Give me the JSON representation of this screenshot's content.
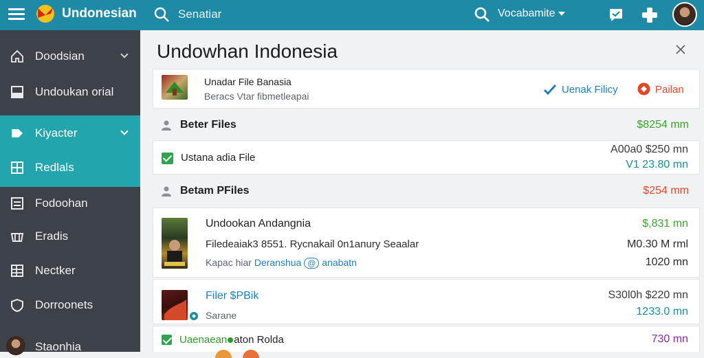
{
  "topbar": {
    "app_name": "Undonesian",
    "search_placeholder": "Senatiar",
    "dropdown_label": "Vocabamite",
    "icons": [
      "menu-icon",
      "logo-icon",
      "search-icon",
      "chat-icon",
      "gamepad-icon"
    ]
  },
  "sidebar": {
    "items": [
      {
        "label": "Doodsian",
        "icon": "home-icon",
        "chevron": true
      },
      {
        "label": "Undoukan orial",
        "icon": "square-icon",
        "chevron": false
      },
      {
        "label": "Kiyacter",
        "icon": "tag-icon",
        "chevron": true
      },
      {
        "label": "Redlals",
        "icon": "grid-icon",
        "chevron": false
      },
      {
        "label": "Fodoohan",
        "icon": "list-icon",
        "chevron": false
      },
      {
        "label": "Eradis",
        "icon": "cart-icon",
        "chevron": false
      },
      {
        "label": "Nectker",
        "icon": "table-icon",
        "chevron": false
      },
      {
        "label": "Dorroonets",
        "icon": "shield-icon",
        "chevron": false
      }
    ],
    "user_label": "Staonhia"
  },
  "main": {
    "title": "Undowhan Indonesia",
    "header_card": {
      "name": "Unadar File Banasia",
      "sub": "Beracs Vtar fibmetleapai",
      "action1": "Uenak Filicy",
      "action2": "Pailan"
    },
    "sections": [
      {
        "label": "Beter Files",
        "amount": "$8254 mm"
      },
      {
        "label": "Betam PFiles",
        "amount": "$254 mm"
      }
    ],
    "file_row": {
      "name": "Ustana adia File",
      "amount1": "A00a0 $250 mn",
      "amount2": "V1 23.80 mn"
    },
    "big_card": {
      "name": "Undookan Andangnia",
      "line2": "Filedeaiak3 8551. Rycnakail 0n1anury Seaalar",
      "line3_a": "Kapac hiar",
      "line3_b": "Deranshua",
      "line3_c": "@",
      "line3_d": "anabatn",
      "amount1": "$,831 mn",
      "amount2": "M0.30 M rml",
      "amount3": "1020 mn"
    },
    "card3": {
      "name": "Filer $PBik",
      "sub": "Sarane",
      "amount1": "S30l0h $220 mn",
      "amount2": "1233.0 mn"
    },
    "last_row": {
      "label_a": "Uaenaean",
      "label_b": "aton Rolda",
      "amount": "730 mn"
    }
  },
  "colors": {
    "topbar": "#1f8aa6",
    "sidebar": "#3d4148",
    "sidebar_active": "#22a5ad",
    "green_amount": "#3aa32a",
    "teal_amount": "#1a8d9e",
    "red_amount": "#e3472a",
    "purple_amount": "#8a2aa6",
    "link_blue": "#1f7fb8"
  }
}
